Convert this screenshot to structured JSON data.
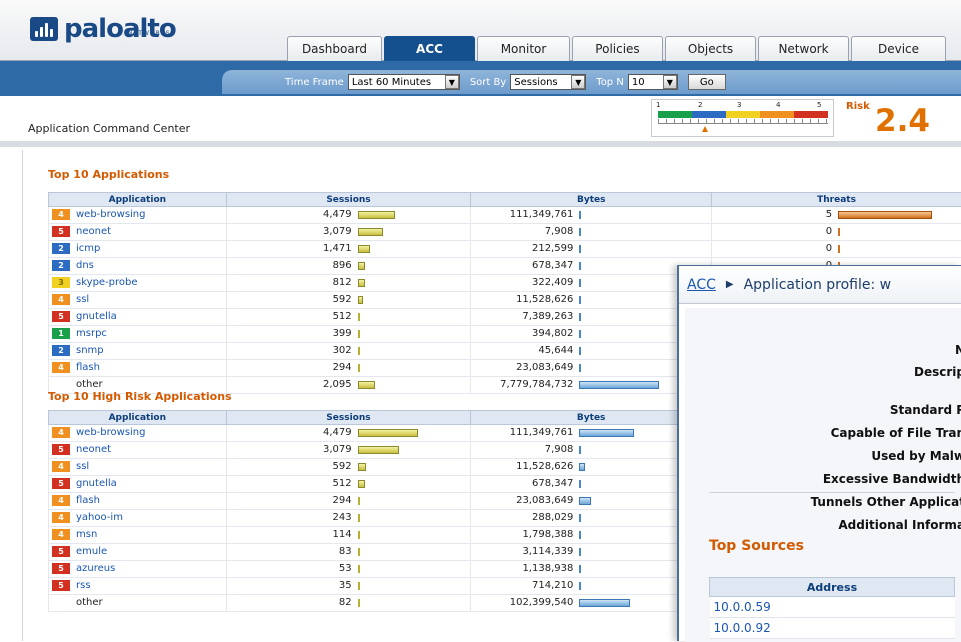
{
  "brand": {
    "name_part1": "palo",
    "name_part2": "alto",
    "sub": "NETWORKS"
  },
  "tabs": [
    {
      "label": "Dashboard",
      "active": false
    },
    {
      "label": "ACC",
      "active": true
    },
    {
      "label": "Monitor",
      "active": false
    },
    {
      "label": "Policies",
      "active": false
    },
    {
      "label": "Objects",
      "active": false
    },
    {
      "label": "Network",
      "active": false
    },
    {
      "label": "Device",
      "active": false
    }
  ],
  "filters": {
    "timeframe_label": "Time Frame",
    "timeframe_value": "Last 60 Minutes",
    "sortby_label": "Sort By",
    "sortby_value": "Sessions",
    "topn_label": "Top N",
    "topn_value": "10",
    "go_label": "Go"
  },
  "page_title": "Application Command Center",
  "risk": {
    "label": "Risk",
    "value": "2.4",
    "scale": [
      "1",
      "2",
      "3",
      "4",
      "5"
    ],
    "level": 2.4
  },
  "colors": {
    "risk1": "#1aa04a",
    "risk2": "#2b6bc2",
    "risk3": "#f0d020",
    "risk4": "#f09020",
    "risk5": "#d23020"
  },
  "top_apps": {
    "title": "Top 10 Applications",
    "headers": [
      "Application",
      "Sessions",
      "Bytes",
      "Threats"
    ],
    "rows": [
      {
        "risk": "4",
        "app": "web-browsing",
        "sessions": "4,479",
        "bytes": "111,349,761",
        "threats": "5",
        "s": 0.6,
        "b": 0.05,
        "t": 1.0
      },
      {
        "risk": "5",
        "app": "neonet",
        "sessions": "3,079",
        "bytes": "7,908",
        "threats": "0",
        "s": 0.41,
        "b": 0.0,
        "t": 0
      },
      {
        "risk": "2",
        "app": "icmp",
        "sessions": "1,471",
        "bytes": "212,599",
        "threats": "0",
        "s": 0.2,
        "b": 0.0,
        "t": 0
      },
      {
        "risk": "2",
        "app": "dns",
        "sessions": "896",
        "bytes": "678,347",
        "threats": "0",
        "s": 0.12,
        "b": 0.0,
        "t": 0
      },
      {
        "risk": "3",
        "app": "skype-probe",
        "sessions": "812",
        "bytes": "322,409",
        "threats": "",
        "s": 0.11,
        "b": 0.0,
        "t": 0
      },
      {
        "risk": "4",
        "app": "ssl",
        "sessions": "592",
        "bytes": "11,528,626",
        "threats": "",
        "s": 0.08,
        "b": 0.0,
        "t": 0
      },
      {
        "risk": "5",
        "app": "gnutella",
        "sessions": "512",
        "bytes": "7,389,263",
        "threats": "",
        "s": 0.07,
        "b": 0.0,
        "t": 0
      },
      {
        "risk": "1",
        "app": "msrpc",
        "sessions": "399",
        "bytes": "394,802",
        "threats": "",
        "s": 0.05,
        "b": 0.0,
        "t": 0
      },
      {
        "risk": "2",
        "app": "snmp",
        "sessions": "302",
        "bytes": "45,644",
        "threats": "",
        "s": 0.04,
        "b": 0.0,
        "t": 0
      },
      {
        "risk": "4",
        "app": "flash",
        "sessions": "294",
        "bytes": "23,083,649",
        "threats": "",
        "s": 0.04,
        "b": 0.0,
        "t": 0
      },
      {
        "risk": "",
        "app": "other",
        "sessions": "2,095",
        "bytes": "7,779,784,732",
        "threats": "",
        "s": 0.28,
        "b": 1.0,
        "t": 0
      }
    ]
  },
  "high_risk": {
    "title": "Top 10 High Risk Applications",
    "headers": [
      "Application",
      "Sessions",
      "Bytes"
    ],
    "rows": [
      {
        "risk": "4",
        "app": "web-browsing",
        "sessions": "4,479",
        "bytes": "111,349,761",
        "s": 1.0,
        "b": 1.0
      },
      {
        "risk": "5",
        "app": "neonet",
        "sessions": "3,079",
        "bytes": "7,908",
        "s": 0.69,
        "b": 0.0
      },
      {
        "risk": "4",
        "app": "ssl",
        "sessions": "592",
        "bytes": "11,528,626",
        "s": 0.13,
        "b": 0.1
      },
      {
        "risk": "5",
        "app": "gnutella",
        "sessions": "512",
        "bytes": "678,347",
        "s": 0.11,
        "b": 0.0
      },
      {
        "risk": "4",
        "app": "flash",
        "sessions": "294",
        "bytes": "23,083,649",
        "s": 0.07,
        "b": 0.21
      },
      {
        "risk": "4",
        "app": "yahoo-im",
        "sessions": "243",
        "bytes": "288,029",
        "s": 0.05,
        "b": 0.0
      },
      {
        "risk": "4",
        "app": "msn",
        "sessions": "114",
        "bytes": "1,798,388",
        "s": 0.03,
        "b": 0.0
      },
      {
        "risk": "5",
        "app": "emule",
        "sessions": "83",
        "bytes": "3,114,339",
        "s": 0.02,
        "b": 0.0
      },
      {
        "risk": "5",
        "app": "azureus",
        "sessions": "53",
        "bytes": "1,138,938",
        "s": 0.01,
        "b": 0.0
      },
      {
        "risk": "5",
        "app": "rss",
        "sessions": "35",
        "bytes": "714,210",
        "s": 0.01,
        "b": 0.0
      },
      {
        "risk": "",
        "app": "other",
        "sessions": "82",
        "bytes": "102,399,540",
        "s": 0.02,
        "b": 0.92
      }
    ]
  },
  "popup": {
    "breadcrumb_link": "ACC",
    "breadcrumb_text": "Application profile: w",
    "labels": [
      "N",
      "Descrip",
      "Standard P",
      "Capable of File Tran",
      "Used by Malw",
      "Excessive Bandwidth",
      "Tunnels Other Applicat",
      "Additional Informa"
    ],
    "top_sources_title": "Top Sources",
    "address_header": "Address",
    "addresses": [
      "10.0.0.59",
      "10.0.0.92"
    ]
  }
}
